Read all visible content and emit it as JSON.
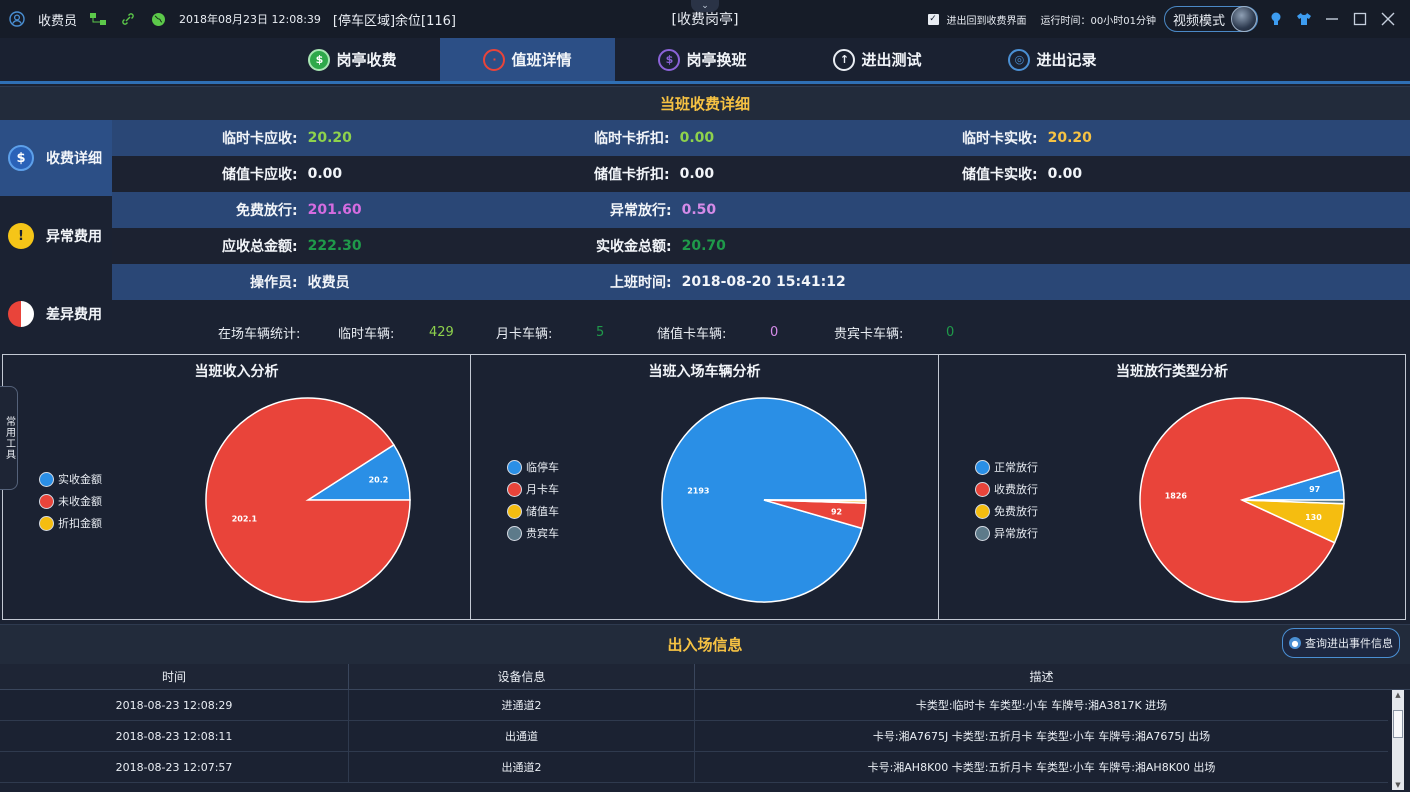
{
  "titlebar": {
    "user": "收费员",
    "datetime": "2018年08月23日 12:08:39",
    "area": "[停车区域]余位[116]",
    "center_title": "[收费岗亭]",
    "checkbox_label": "进出回到收费界面",
    "runtime": "运行时间：00小时01分钟",
    "video_mode": "视频模式"
  },
  "nav": {
    "tabs": [
      {
        "label": "岗亭收费"
      },
      {
        "label": "值班详情"
      },
      {
        "label": "岗亭换班"
      },
      {
        "label": "进出测试"
      },
      {
        "label": "进出记录"
      }
    ]
  },
  "section_title": "当班收费详细",
  "side": {
    "items": [
      {
        "label": "收费详细"
      },
      {
        "label": "异常费用"
      },
      {
        "label": "差异费用"
      }
    ]
  },
  "details": {
    "temp_due_label": "临时卡应收:",
    "temp_due": "20.20",
    "temp_discount_label": "临时卡折扣:",
    "temp_discount": "0.00",
    "temp_paid_label": "临时卡实收:",
    "temp_paid": "20.20",
    "stored_due_label": "储值卡应收:",
    "stored_due": "0.00",
    "stored_discount_label": "储值卡折扣:",
    "stored_discount": "0.00",
    "stored_paid_label": "储值卡实收:",
    "stored_paid": "0.00",
    "free_label": "免费放行:",
    "free": "201.60",
    "abnormal_label": "异常放行:",
    "abnormal": "0.50",
    "total_due_label": "应收总金额:",
    "total_due": "222.30",
    "total_paid_label": "实收金总额:",
    "total_paid": "20.70",
    "operator_label": "操作员:",
    "operator": "收费员",
    "shift_time_label": "上班时间:",
    "shift_time": "2018-08-20 15:41:12"
  },
  "stats": {
    "label": "在场车辆统计:",
    "temp_label": "临时车辆:",
    "temp": "429",
    "monthly_label": "月卡车辆:",
    "monthly": "5",
    "stored_label": "储值卡车辆:",
    "stored": "0",
    "vip_label": "贵宾卡车辆:",
    "vip": "0"
  },
  "tools_tab": "常用工具",
  "chart_data": [
    {
      "type": "pie",
      "title": "当班收入分析",
      "labels": [
        "实收金额",
        "未收金额",
        "折扣金额"
      ],
      "values": [
        20.2,
        202.1,
        0
      ],
      "data_labels": [
        "20.2",
        "202.1",
        "0"
      ],
      "colors": [
        "#2a8fe6",
        "#e9443a",
        "#f5bd10"
      ]
    },
    {
      "type": "pie",
      "title": "当班入场车辆分析",
      "labels": [
        "临停车",
        "月卡车",
        "储值车",
        "贵宾车"
      ],
      "values": [
        2193,
        92,
        8,
        3
      ],
      "data_labels": [
        "2193",
        "92",
        "",
        ""
      ],
      "colors": [
        "#2a8fe6",
        "#e9443a",
        "#f5bd10",
        "#5d7a8a"
      ]
    },
    {
      "type": "pie",
      "title": "当班放行类型分析",
      "labels": [
        "正常放行",
        "收费放行",
        "免费放行",
        "异常放行"
      ],
      "values": [
        97,
        1826,
        130,
        12
      ],
      "data_labels": [
        "97",
        "1826",
        "130",
        ""
      ],
      "colors": [
        "#2a8fe6",
        "#e9443a",
        "#f5bd10",
        "#5d7a8a"
      ]
    }
  ],
  "records": {
    "title": "出入场信息",
    "query_button": "查询进出事件信息",
    "columns": [
      "时间",
      "设备信息",
      "描述"
    ],
    "rows": [
      {
        "time": "2018-08-23 12:08:29",
        "device": "进通道2",
        "desc": "卡类型:临时卡 车类型:小车 车牌号:湘A3817K 进场"
      },
      {
        "time": "2018-08-23 12:08:11",
        "device": "出通道",
        "desc": "卡号:湘A7675J 卡类型:五折月卡 车类型:小车 车牌号:湘A7675J 出场"
      },
      {
        "time": "2018-08-23 12:07:57",
        "device": "出通道2",
        "desc": "卡号:湘AH8K00 卡类型:五折月卡 车类型:小车 车牌号:湘AH8K00 出场"
      }
    ]
  }
}
